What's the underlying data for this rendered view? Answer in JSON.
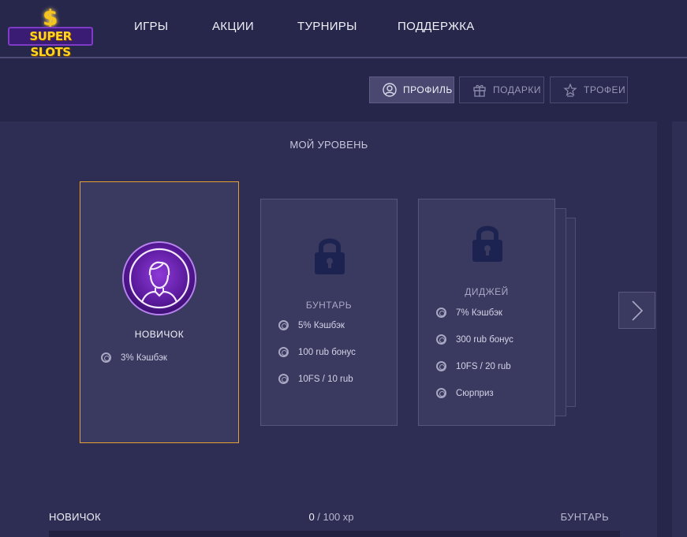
{
  "header": {
    "logo": {
      "dollar": "$",
      "text": "SUPER SLOTS"
    },
    "nav": [
      {
        "label": "ИГРЫ"
      },
      {
        "label": "АКЦИИ"
      },
      {
        "label": "ТУРНИРЫ"
      },
      {
        "label": "ПОДДЕРЖКА"
      }
    ]
  },
  "tabs": [
    {
      "label": "ПРОФИЛЬ",
      "icon": "user-circle-icon",
      "active": true
    },
    {
      "label": "ПОДАРКИ",
      "icon": "gift-icon",
      "active": false
    },
    {
      "label": "ТРОФЕИ",
      "icon": "trophy-icon",
      "active": false
    }
  ],
  "level_section": {
    "title": "МОЙ УРОВЕНЬ",
    "levels": [
      {
        "name": "НОВИЧОК",
        "icon": "avatar-icon",
        "locked": false,
        "perks": [
          "3% Кэшбэк"
        ]
      },
      {
        "name": "БУНТАРЬ",
        "icon": "lock-icon",
        "locked": true,
        "perks": [
          "5% Кэшбэк",
          "100 rub бонус",
          "10FS / 10 rub"
        ]
      },
      {
        "name": "ДИДЖЕЙ",
        "icon": "lock-icon",
        "locked": true,
        "perks": [
          "7% Кэшбэк",
          "300 rub бонус",
          "10FS / 20 rub",
          "Сюрприз"
        ]
      }
    ],
    "next_icon": "chevron-right-icon"
  },
  "progress": {
    "current_level": "НОВИЧОК",
    "next_level": "БУНТАРЬ",
    "xp_current": "0",
    "xp_suffix": " / 100 xp",
    "fraction": 0
  },
  "colors": {
    "accent": "#e8a033",
    "background": "#26254a",
    "panel": "#2e2d54",
    "card": "#3a3960"
  }
}
